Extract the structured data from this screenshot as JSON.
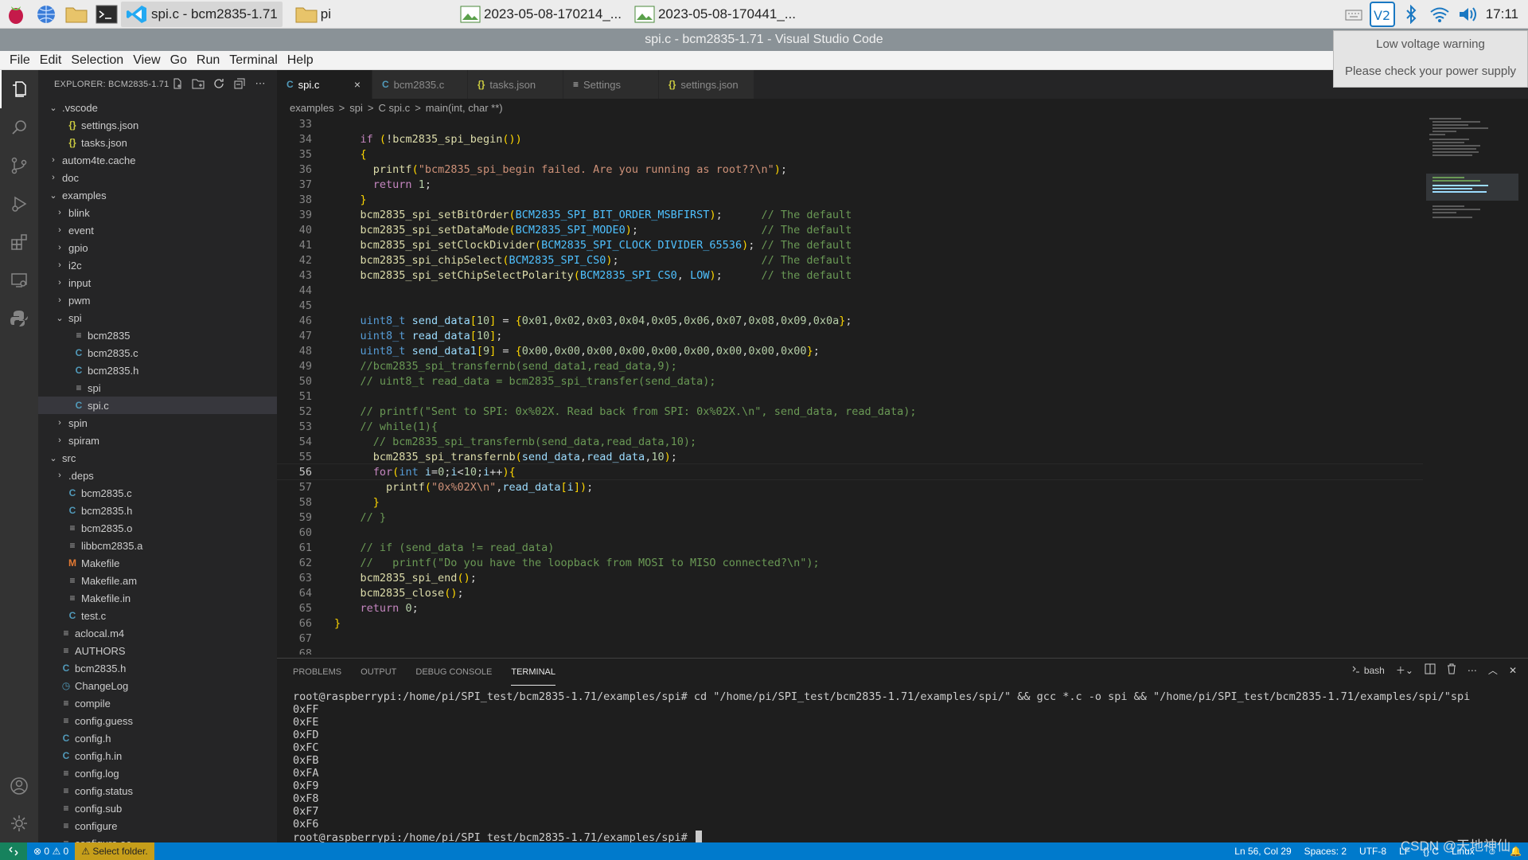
{
  "taskbar": {
    "windows": [
      {
        "label": "spi.c - bcm2835-1.71",
        "active": true
      },
      {
        "label": "pi"
      },
      {
        "label": "2023-05-08-170214_..."
      },
      {
        "label": "2023-05-08-170441_..."
      }
    ],
    "clock": "17:11"
  },
  "notification": {
    "line1": "Low voltage warning",
    "line2": "Please check your power supply"
  },
  "window": {
    "title": "spi.c - bcm2835-1.71 - Visual Studio Code"
  },
  "menu": [
    "File",
    "Edit",
    "Selection",
    "View",
    "Go",
    "Run",
    "Terminal",
    "Help"
  ],
  "sidebar": {
    "title": "EXPLORER: BCM2835-1.71",
    "tree": [
      {
        "depth": 0,
        "kind": "folder",
        "open": true,
        "label": ".vscode"
      },
      {
        "depth": 1,
        "kind": "json",
        "label": "settings.json"
      },
      {
        "depth": 1,
        "kind": "json",
        "label": "tasks.json"
      },
      {
        "depth": 0,
        "kind": "folder",
        "open": false,
        "label": "autom4te.cache"
      },
      {
        "depth": 0,
        "kind": "folder",
        "open": false,
        "label": "doc"
      },
      {
        "depth": 0,
        "kind": "folder",
        "open": true,
        "label": "examples"
      },
      {
        "depth": 1,
        "kind": "folder",
        "open": false,
        "label": "blink"
      },
      {
        "depth": 1,
        "kind": "folder",
        "open": false,
        "label": "event"
      },
      {
        "depth": 1,
        "kind": "folder",
        "open": false,
        "label": "gpio"
      },
      {
        "depth": 1,
        "kind": "folder",
        "open": false,
        "label": "i2c"
      },
      {
        "depth": 1,
        "kind": "folder",
        "open": false,
        "label": "input"
      },
      {
        "depth": 1,
        "kind": "folder",
        "open": false,
        "label": "pwm"
      },
      {
        "depth": 1,
        "kind": "folder",
        "open": true,
        "label": "spi"
      },
      {
        "depth": 2,
        "kind": "txt",
        "label": "bcm2835"
      },
      {
        "depth": 2,
        "kind": "c",
        "label": "bcm2835.c"
      },
      {
        "depth": 2,
        "kind": "c",
        "label": "bcm2835.h"
      },
      {
        "depth": 2,
        "kind": "txt",
        "label": "spi"
      },
      {
        "depth": 2,
        "kind": "c",
        "label": "spi.c",
        "selected": true
      },
      {
        "depth": 1,
        "kind": "folder",
        "open": false,
        "label": "spin"
      },
      {
        "depth": 1,
        "kind": "folder",
        "open": false,
        "label": "spiram"
      },
      {
        "depth": 0,
        "kind": "folder",
        "open": true,
        "label": "src"
      },
      {
        "depth": 1,
        "kind": "folder",
        "open": false,
        "label": ".deps"
      },
      {
        "depth": 1,
        "kind": "c",
        "label": "bcm2835.c"
      },
      {
        "depth": 1,
        "kind": "c",
        "label": "bcm2835.h"
      },
      {
        "depth": 1,
        "kind": "txt",
        "label": "bcm2835.o"
      },
      {
        "depth": 1,
        "kind": "txt",
        "label": "libbcm2835.a"
      },
      {
        "depth": 1,
        "kind": "m",
        "label": "Makefile"
      },
      {
        "depth": 1,
        "kind": "txt",
        "label": "Makefile.am"
      },
      {
        "depth": 1,
        "kind": "txt",
        "label": "Makefile.in"
      },
      {
        "depth": 1,
        "kind": "c",
        "label": "test.c"
      },
      {
        "depth": 0,
        "kind": "txt",
        "label": "aclocal.m4"
      },
      {
        "depth": 0,
        "kind": "txt",
        "label": "AUTHORS"
      },
      {
        "depth": 0,
        "kind": "c",
        "label": "bcm2835.h"
      },
      {
        "depth": 0,
        "kind": "hist",
        "label": "ChangeLog"
      },
      {
        "depth": 0,
        "kind": "txt",
        "label": "compile"
      },
      {
        "depth": 0,
        "kind": "txt",
        "label": "config.guess"
      },
      {
        "depth": 0,
        "kind": "c",
        "label": "config.h"
      },
      {
        "depth": 0,
        "kind": "c",
        "label": "config.h.in"
      },
      {
        "depth": 0,
        "kind": "txt",
        "label": "config.log"
      },
      {
        "depth": 0,
        "kind": "txt",
        "label": "config.status"
      },
      {
        "depth": 0,
        "kind": "txt",
        "label": "config.sub"
      },
      {
        "depth": 0,
        "kind": "txt",
        "label": "configure"
      },
      {
        "depth": 0,
        "kind": "txt",
        "label": "configure.ac"
      }
    ]
  },
  "tabs": [
    {
      "label": "spi.c",
      "icon": "C",
      "kind": "c",
      "active": true,
      "close": "×"
    },
    {
      "label": "bcm2835.c",
      "icon": "C",
      "kind": "c"
    },
    {
      "label": "tasks.json",
      "icon": "{}",
      "kind": "json"
    },
    {
      "label": "Settings",
      "icon": "≡",
      "kind": "txt"
    },
    {
      "label": "settings.json",
      "icon": "{}",
      "kind": "json"
    }
  ],
  "breadcrumb": [
    "examples",
    ">",
    "spi",
    ">",
    "C spi.c",
    ">",
    "main(int, char **)"
  ],
  "editor": {
    "current_line": 56,
    "lines": [
      {
        "n": "33",
        "t": ""
      },
      {
        "n": "34",
        "t": "    if (!bcm2835_spi_begin())"
      },
      {
        "n": "35",
        "t": "    {"
      },
      {
        "n": "36",
        "t": "      printf(\"bcm2835_spi_begin failed. Are you running as root??\\n\");"
      },
      {
        "n": "37",
        "t": "      return 1;"
      },
      {
        "n": "38",
        "t": "    }"
      },
      {
        "n": "39",
        "t": "    bcm2835_spi_setBitOrder(BCM2835_SPI_BIT_ORDER_MSBFIRST);      // The default"
      },
      {
        "n": "40",
        "t": "    bcm2835_spi_setDataMode(BCM2835_SPI_MODE0);                   // The default"
      },
      {
        "n": "41",
        "t": "    bcm2835_spi_setClockDivider(BCM2835_SPI_CLOCK_DIVIDER_65536); // The default"
      },
      {
        "n": "42",
        "t": "    bcm2835_spi_chipSelect(BCM2835_SPI_CS0);                      // The default"
      },
      {
        "n": "43",
        "t": "    bcm2835_spi_setChipSelectPolarity(BCM2835_SPI_CS0, LOW);      // the default"
      },
      {
        "n": "44",
        "t": ""
      },
      {
        "n": "45",
        "t": ""
      },
      {
        "n": "46",
        "t": "    uint8_t send_data[10] = {0x01,0x02,0x03,0x04,0x05,0x06,0x07,0x08,0x09,0x0a};"
      },
      {
        "n": "47",
        "t": "    uint8_t read_data[10];"
      },
      {
        "n": "48",
        "t": "    uint8_t send_data1[9] = {0x00,0x00,0x00,0x00,0x00,0x00,0x00,0x00,0x00};"
      },
      {
        "n": "49",
        "t": "    //bcm2835_spi_transfernb(send_data1,read_data,9);"
      },
      {
        "n": "50",
        "t": "    // uint8_t read_data = bcm2835_spi_transfer(send_data);"
      },
      {
        "n": "51",
        "t": ""
      },
      {
        "n": "52",
        "t": "    // printf(\"Sent to SPI: 0x%02X. Read back from SPI: 0x%02X.\\n\", send_data, read_data);"
      },
      {
        "n": "53",
        "t": "    // while(1){"
      },
      {
        "n": "54",
        "t": "      // bcm2835_spi_transfernb(send_data,read_data,10);"
      },
      {
        "n": "55",
        "t": "      bcm2835_spi_transfernb(send_data,read_data,10);"
      },
      {
        "n": "56",
        "t": "      for(int i=0;i<10;i++){"
      },
      {
        "n": "57",
        "t": "        printf(\"0x%02X\\n\",read_data[i]);"
      },
      {
        "n": "58",
        "t": "      }"
      },
      {
        "n": "59",
        "t": "    // }"
      },
      {
        "n": "60",
        "t": ""
      },
      {
        "n": "61",
        "t": "    // if (send_data != read_data)"
      },
      {
        "n": "62",
        "t": "    //   printf(\"Do you have the loopback from MOSI to MISO connected?\\n\");"
      },
      {
        "n": "63",
        "t": "    bcm2835_spi_end();"
      },
      {
        "n": "64",
        "t": "    bcm2835_close();"
      },
      {
        "n": "65",
        "t": "    return 0;"
      },
      {
        "n": "66",
        "t": "}"
      },
      {
        "n": "67",
        "t": ""
      },
      {
        "n": "68",
        "t": ""
      }
    ]
  },
  "panel": {
    "tabs": [
      "PROBLEMS",
      "OUTPUT",
      "DEBUG CONSOLE",
      "TERMINAL"
    ],
    "active": "TERMINAL",
    "shell": "bash",
    "terminal_lines": [
      "root@raspberrypi:/home/pi/SPI_test/bcm2835-1.71/examples/spi# cd \"/home/pi/SPI_test/bcm2835-1.71/examples/spi/\" && gcc *.c -o spi && \"/home/pi/SPI_test/bcm2835-1.71/examples/spi/\"spi",
      "0xFF",
      "0xFE",
      "0xFD",
      "0xFC",
      "0xFB",
      "0xFA",
      "0xF9",
      "0xF8",
      "0xF7",
      "0xF6"
    ],
    "prompt": "root@raspberrypi:/home/pi/SPI_test/bcm2835-1.71/examples/spi# "
  },
  "status": {
    "errors": "0",
    "warnings": "0",
    "select_folder": "Select folder.",
    "position": "Ln 56, Col 29",
    "spaces": "Spaces: 2",
    "encoding": "UTF-8",
    "eol": "LF",
    "language": "C",
    "platform": "Linux"
  },
  "watermark": "CSDN @天地神仙",
  "colors": {
    "keyword": "#569cd6",
    "control": "#c586c0",
    "function": "#dcdcaa",
    "string": "#ce9178",
    "comment": "#6a9955",
    "number": "#b5cea8",
    "variable": "#9cdcfe",
    "constant": "#4fc1ff",
    "type": "#569cd6",
    "statusbar": "#007acc"
  }
}
